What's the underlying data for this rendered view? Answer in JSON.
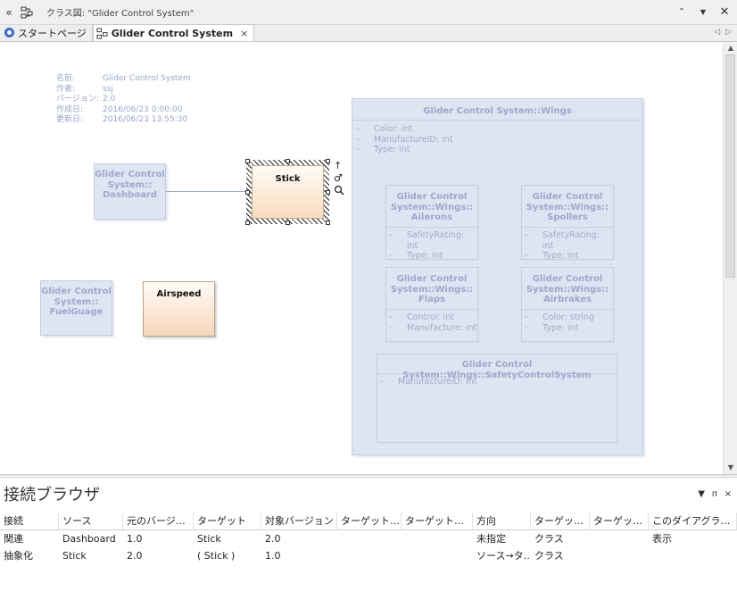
{
  "titlebar": {
    "title": "クラス図: \"Glider Control System\"",
    "collapse_icon": "double-chevron-left-icon",
    "diagram_icon": "class-diagram-icon",
    "controls": [
      "chevron-up-icon",
      "dropdown-icon",
      "close-icon"
    ]
  },
  "tabs": [
    {
      "label": "スタートページ",
      "icon": "start-page-icon",
      "active": false
    },
    {
      "label": "Glider Control System",
      "icon": "class-diagram-icon",
      "active": true,
      "close": "×"
    }
  ],
  "diagram": {
    "meta": [
      {
        "key": "名前:",
        "value": "Glider Control System"
      },
      {
        "key": "作者:",
        "value": "ssj"
      },
      {
        "key": "バージョン:",
        "value": "2.0"
      },
      {
        "key": "作成日:",
        "value": "2016/06/23 0:00:00"
      },
      {
        "key": "更新日:",
        "value": "2016/06/23 13:55:30"
      }
    ],
    "dashboard": "Glider Control\nSystem::\nDashboard",
    "fuelgauge": "Glider Control\nSystem::\nFuelGuage",
    "stick": "Stick",
    "airspeed": "Airspeed",
    "wings": {
      "title": "Glider Control System::Wings",
      "attrs": [
        "Color: int",
        "ManufactureID: int",
        "Type: int"
      ]
    },
    "ailerons": {
      "title": "Glider Control\nSystem::Wings::\nAilerons",
      "attrs": [
        "SafetyRating: int",
        "Type: int"
      ]
    },
    "spoilers": {
      "title": "Glider Control\nSystem::Wings::\nSpollers",
      "attrs": [
        "SafetyRating: int",
        "Type: int"
      ]
    },
    "flaps": {
      "title": "Glider Control\nSystem::Wings::\nFlaps",
      "attrs": [
        "Control: int",
        "Manufacture: int"
      ]
    },
    "airbrakes": {
      "title": "Glider Control\nSystem::Wings::\nAirbrakes",
      "attrs": [
        "Color: string",
        "Type: int"
      ]
    },
    "safety": {
      "title": "Glider Control System::Wings::SafetyControlSystem",
      "attrs": [
        "ManufactureID: int"
      ]
    },
    "attr_marker": "-",
    "tools": {
      "arrow": "↑",
      "person": "♂",
      "zoom": "🔍"
    }
  },
  "browser": {
    "title": "接続ブラウザ",
    "controls": {
      "menu": "▼",
      "pin": "ᴨ",
      "close": "×"
    },
    "columns": [
      "接続",
      "ソース",
      "元のバージ…",
      "ターゲット",
      "対象バージョン",
      "ターゲット…",
      "ターゲット…",
      "方向",
      "ターゲッ…",
      "ターゲッ…",
      "このダイアグラ…"
    ],
    "rows": [
      [
        "関連",
        "Dashboard",
        "1.0",
        "Stick",
        "2.0",
        "",
        "",
        "未指定",
        "クラス",
        "",
        "表示"
      ],
      [
        "抽象化",
        "Stick",
        "2.0",
        "( Stick )",
        "1.0",
        "",
        "",
        "ソース→タ…",
        "クラス",
        "",
        ""
      ]
    ]
  }
}
